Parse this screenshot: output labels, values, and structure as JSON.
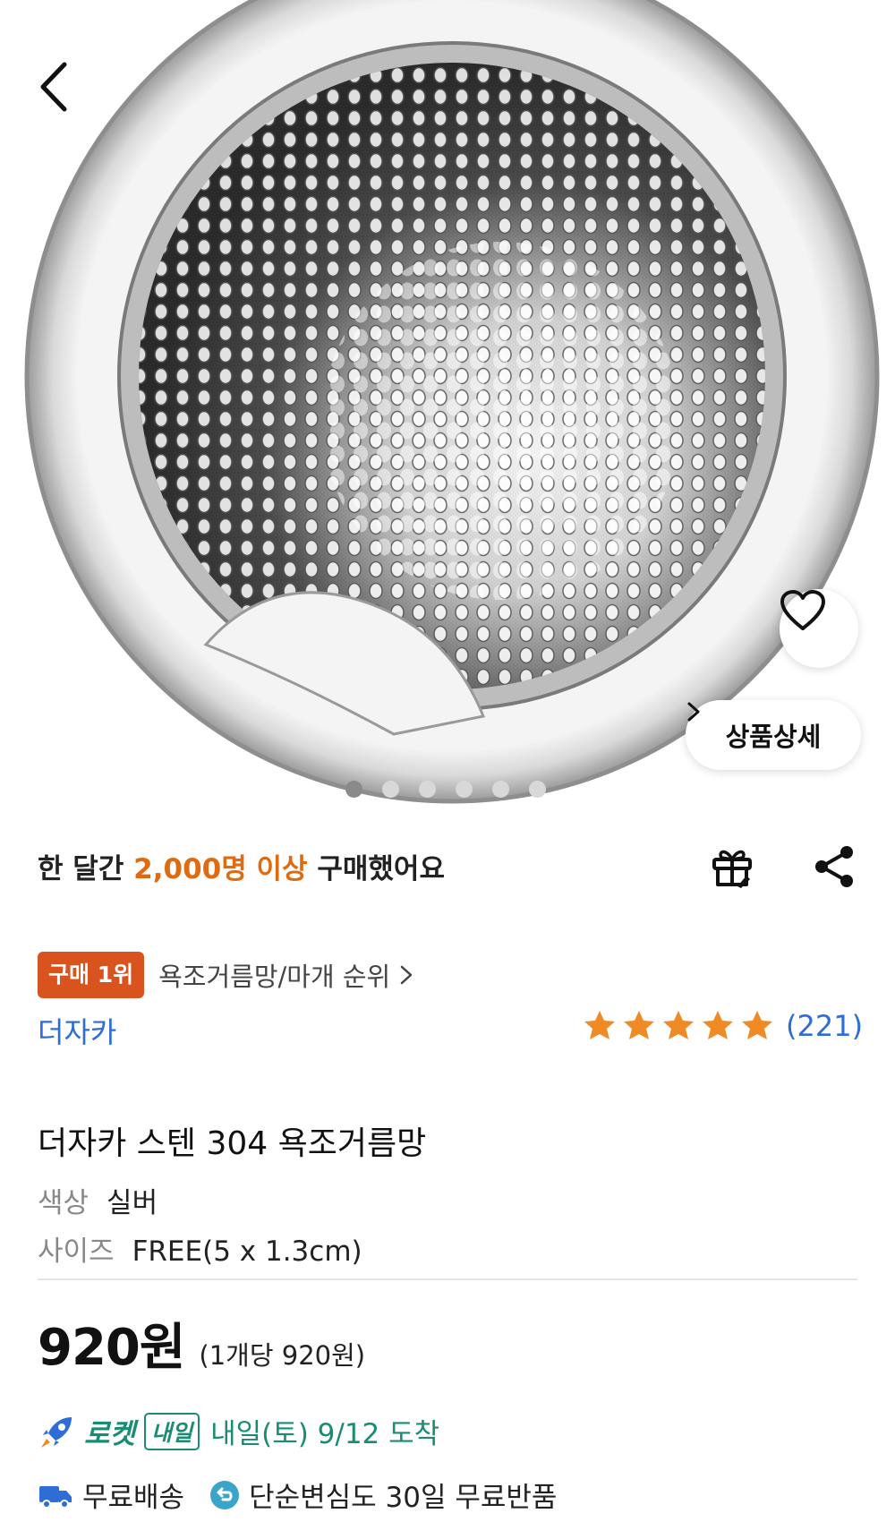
{
  "hero": {
    "image_alt": "stainless steel bath drain strainer",
    "detail_button_label": "상품상세",
    "image_count": 6,
    "active_image_index": 0
  },
  "purchase": {
    "prefix": "한 달간 ",
    "highlight": "2,000명 이상",
    "suffix": " 구매했어요"
  },
  "rank": {
    "badge": "구매 1위",
    "category": "욕조거름망/마개 순위"
  },
  "brand": "더자카",
  "rating": {
    "stars": 5,
    "review_count": "(221)"
  },
  "product": {
    "title": "더자카 스텐 304 욕조거름망",
    "options": [
      {
        "key": "색상",
        "value": "실버"
      },
      {
        "key": "사이즈",
        "value": "FREE(5 x 1.3cm)"
      }
    ]
  },
  "price": {
    "amount": "920원",
    "unit_price": "(1개당 920원)"
  },
  "delivery": {
    "rocket_label": "로켓",
    "tomorrow_badge": "내일",
    "arrival": "내일(토) 9/12 도착"
  },
  "benefits": {
    "free_shipping": "무료배송",
    "free_return": "단순변심도 30일 무료반품"
  },
  "colors": {
    "accent_orange": "#e06a10",
    "rank_badge": "#d9531e",
    "brand_blue": "#2e6cd6",
    "rocket_green": "#1a8c74",
    "star": "#f08a24"
  }
}
